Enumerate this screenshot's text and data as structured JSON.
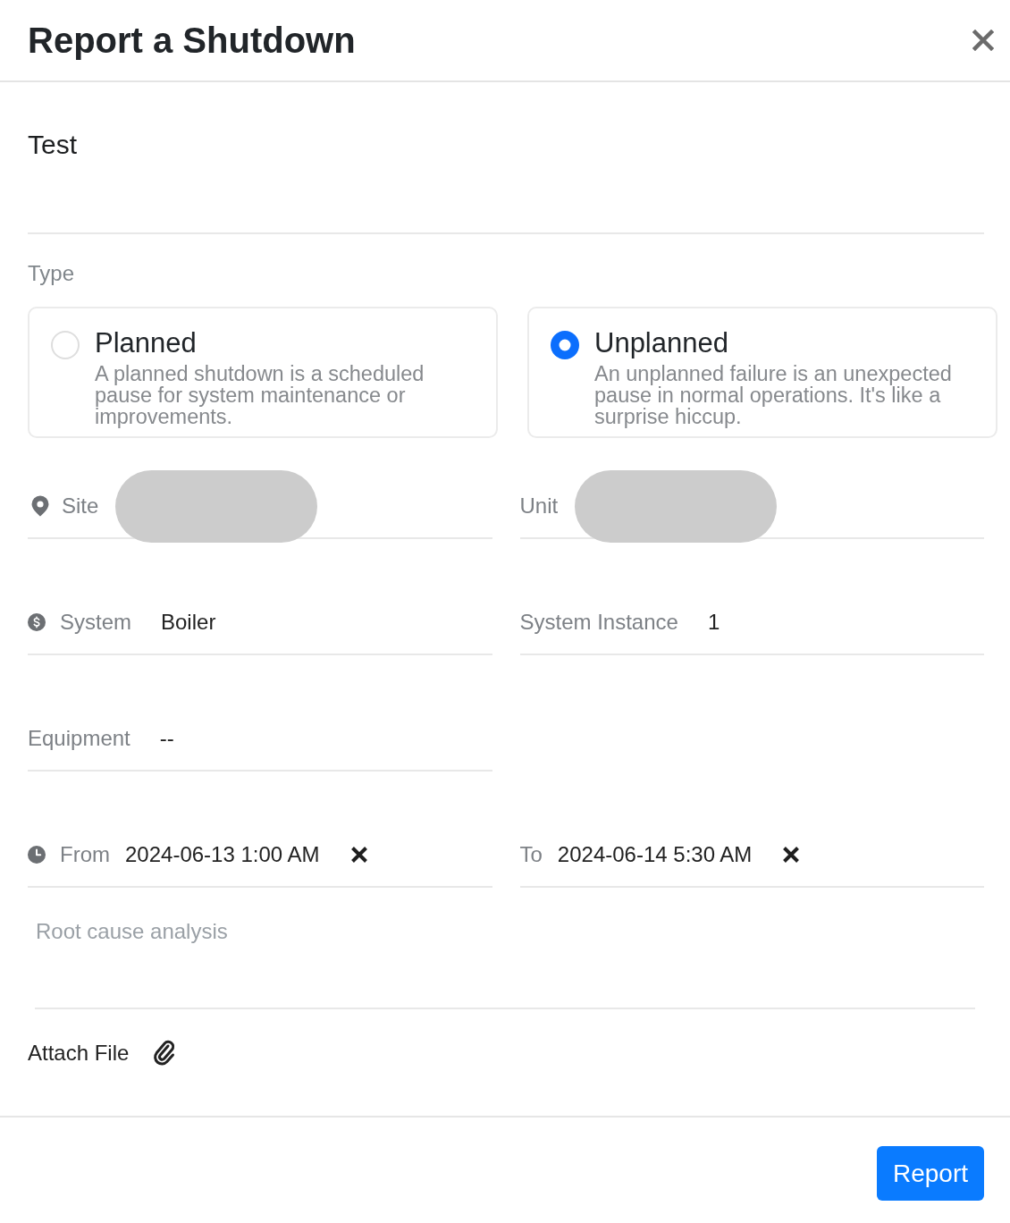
{
  "dialog": {
    "title": "Report a Shutdown"
  },
  "title_field": {
    "value": "Test"
  },
  "type": {
    "label": "Type",
    "options": [
      {
        "label": "Planned",
        "description": "A planned shutdown is a scheduled pause for system maintenance or improvements.",
        "selected": false
      },
      {
        "label": "Unplanned",
        "description": "An unplanned failure is an unexpected pause in normal operations. It's like a surprise hiccup.",
        "selected": true
      }
    ]
  },
  "fields": [
    [
      {
        "kind": "location",
        "label": "Site",
        "redacted": true,
        "clearable": false
      },
      {
        "kind": "plain",
        "label": "Unit",
        "redacted": true,
        "clearable": false
      }
    ],
    [
      {
        "kind": "cost",
        "label": "System",
        "value": "Boiler",
        "redacted": false,
        "clearable": false
      },
      {
        "kind": "plain",
        "label": "System Instance",
        "value": "1",
        "redacted": false,
        "clearable": false
      }
    ],
    [
      {
        "kind": "plain",
        "label": "Equipment",
        "value": "--",
        "redacted": false,
        "clearable": false
      }
    ],
    [
      {
        "kind": "time",
        "label": "From",
        "value": "2024-06-13 1:00 AM",
        "redacted": false,
        "clearable": true
      },
      {
        "kind": "plain",
        "label": "To",
        "value": "2024-06-14 5:30 AM",
        "redacted": false,
        "clearable": true
      }
    ]
  ],
  "root_cause": {
    "placeholder": "Root cause analysis"
  },
  "attachment": {
    "label": "Attach File"
  },
  "footer": {
    "submit": "Report"
  }
}
